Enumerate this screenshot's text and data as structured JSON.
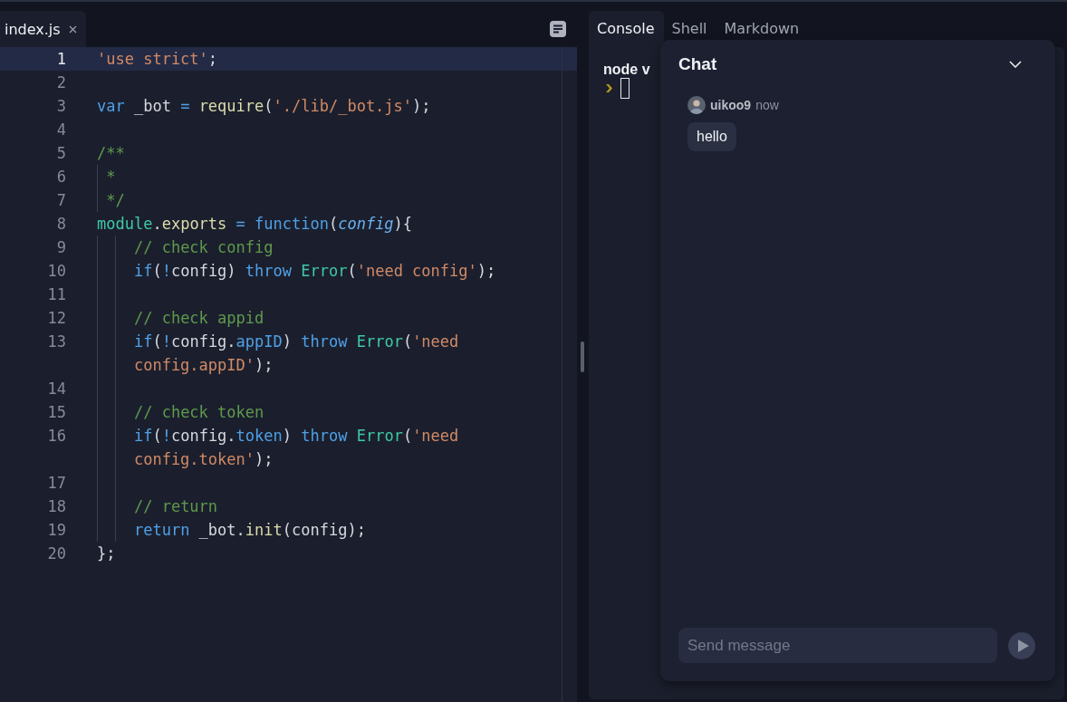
{
  "editor": {
    "tabs": [
      {
        "label": "index.js",
        "selected": true
      }
    ],
    "lines": [
      {
        "number": "1",
        "selected": true,
        "tokens": [
          {
            "kind": "string",
            "text": "'use strict'"
          },
          {
            "kind": "plain",
            "text": ";"
          }
        ]
      },
      {
        "number": "2",
        "selected": false
      },
      {
        "number": "3",
        "selected": false,
        "tokens": [
          {
            "kind": "keyword",
            "text": "var"
          },
          {
            "kind": "plain",
            "text": " _bot "
          },
          {
            "kind": "operator",
            "text": "="
          },
          {
            "kind": "function",
            "text": " require"
          },
          {
            "kind": "plain",
            "text": "("
          },
          {
            "kind": "string",
            "text": "'./lib/_bot.js'"
          },
          {
            "kind": "plain",
            "text": ");"
          }
        ]
      },
      {
        "number": "4",
        "selected": false
      },
      {
        "number": "5",
        "selected": false,
        "tokens": [
          {
            "kind": "comment",
            "text": "/**"
          }
        ]
      },
      {
        "number": "6",
        "selected": false,
        "tokens": [
          {
            "kind": "comment",
            "text": " *"
          }
        ]
      },
      {
        "number": "7",
        "selected": false,
        "tokens": [
          {
            "kind": "comment",
            "text": " */"
          }
        ]
      },
      {
        "number": "8",
        "selected": false,
        "tokens": [
          {
            "kind": "class",
            "text": "module"
          },
          {
            "kind": "plain",
            "text": "."
          },
          {
            "kind": "function",
            "text": "exports"
          },
          {
            "kind": "operator",
            "text": " = "
          },
          {
            "kind": "keyword",
            "text": "function"
          },
          {
            "kind": "plain",
            "text": "("
          },
          {
            "kind": "param",
            "text": "config"
          },
          {
            "kind": "plain",
            "text": "){"
          }
        ]
      },
      {
        "number": "9",
        "selected": false,
        "tokens": [
          {
            "kind": "comment",
            "text": "    // check config"
          }
        ]
      },
      {
        "number": "10",
        "selected": false,
        "tokens": [
          {
            "kind": "keyword",
            "text": "    if"
          },
          {
            "kind": "plain",
            "text": "("
          },
          {
            "kind": "operator",
            "text": "!"
          },
          {
            "kind": "plain",
            "text": "config) "
          },
          {
            "kind": "keyword",
            "text": "throw"
          },
          {
            "kind": "class",
            "text": " Error"
          },
          {
            "kind": "plain",
            "text": "("
          },
          {
            "kind": "string",
            "text": "'need config'"
          },
          {
            "kind": "plain",
            "text": ");"
          }
        ]
      },
      {
        "number": "11",
        "selected": false
      },
      {
        "number": "12",
        "selected": false,
        "tokens": [
          {
            "kind": "comment",
            "text": "    // check appid"
          }
        ]
      },
      {
        "number": "13",
        "selected": false,
        "tokens": [
          {
            "kind": "keyword",
            "text": "    if"
          },
          {
            "kind": "plain",
            "text": "("
          },
          {
            "kind": "operator",
            "text": "!"
          },
          {
            "kind": "plain",
            "text": "config."
          },
          {
            "kind": "property",
            "text": "appID"
          },
          {
            "kind": "plain",
            "text": ") "
          },
          {
            "kind": "keyword",
            "text": "throw"
          },
          {
            "kind": "class",
            "text": " Error"
          },
          {
            "kind": "plain",
            "text": "("
          },
          {
            "kind": "string",
            "text": "'need config.appID'"
          },
          {
            "kind": "plain",
            "text": ");"
          }
        ]
      },
      {
        "number": "14",
        "selected": false
      },
      {
        "number": "15",
        "selected": false,
        "tokens": [
          {
            "kind": "comment",
            "text": "    // check token"
          }
        ]
      },
      {
        "number": "16",
        "selected": false,
        "tokens": [
          {
            "kind": "keyword",
            "text": "    if"
          },
          {
            "kind": "plain",
            "text": "("
          },
          {
            "kind": "operator",
            "text": "!"
          },
          {
            "kind": "plain",
            "text": "config."
          },
          {
            "kind": "property",
            "text": "token"
          },
          {
            "kind": "plain",
            "text": ") "
          },
          {
            "kind": "keyword",
            "text": "throw"
          },
          {
            "kind": "class",
            "text": " Error"
          },
          {
            "kind": "plain",
            "text": "("
          },
          {
            "kind": "string",
            "text": "'need config.token'"
          },
          {
            "kind": "plain",
            "text": ");"
          }
        ]
      },
      {
        "number": "17",
        "selected": false
      },
      {
        "number": "18",
        "selected": false,
        "tokens": [
          {
            "kind": "comment",
            "text": "    // return"
          }
        ]
      },
      {
        "number": "19",
        "selected": false,
        "tokens": [
          {
            "kind": "keyword",
            "text": "    return"
          },
          {
            "kind": "plain",
            "text": " _bot."
          },
          {
            "kind": "function",
            "text": "init"
          },
          {
            "kind": "plain",
            "text": "(config);"
          }
        ]
      },
      {
        "number": "20",
        "selected": false,
        "tokens": [
          {
            "kind": "plain",
            "text": "};"
          }
        ]
      }
    ]
  },
  "right_pane": {
    "tabs": [
      {
        "label": "Console",
        "selected": true
      },
      {
        "label": "Shell",
        "selected": false
      },
      {
        "label": "Markdown",
        "selected": false
      }
    ],
    "console": {
      "output": "node v"
    }
  },
  "chat": {
    "title": "Chat",
    "messages": [
      {
        "author": "uikoo9",
        "time": "now",
        "text": "hello"
      }
    ],
    "input": {
      "placeholder": "Send message"
    }
  }
}
